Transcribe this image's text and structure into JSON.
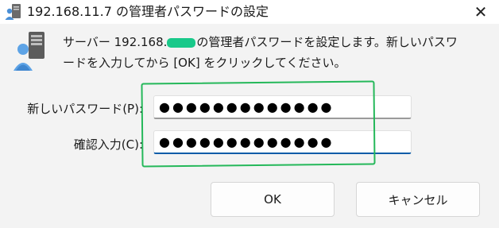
{
  "window": {
    "title": "192.168.11.7 の管理者パスワードの設定",
    "close_glyph": "✕"
  },
  "message": {
    "line1_prefix": "サーバー 192.168.",
    "line1_suffix": "の管理者パスワードを設定します。新しいパスワ",
    "line2": "ードを入力してから [OK] をクリックしてください。"
  },
  "fields": {
    "new_password_label": "新しいパスワード(P):",
    "new_password_value": "●●●●●●●●●●●●●",
    "confirm_label": "確認入力(C):",
    "confirm_value": "●●●●●●●●●●●●●"
  },
  "buttons": {
    "ok": "OK",
    "cancel": "キャンセル"
  },
  "icons": {
    "app": "server-user-icon",
    "message": "user-server-icon",
    "close": "close-icon"
  },
  "colors": {
    "annotation": "#25b85a",
    "redaction": "#19c98a",
    "focus": "#0b5ca8"
  }
}
